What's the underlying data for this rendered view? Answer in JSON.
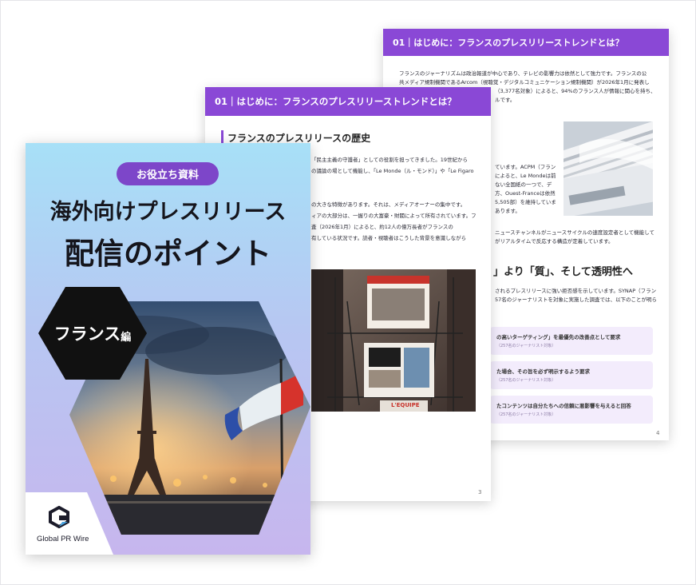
{
  "page_back": {
    "header": "01｜はじめに：フランスのプレスリリーストレンドとは？",
    "lines": [
      "フランスのジャーナリズムは政治報道が中心であり、テレビの影響力は依然として強力です。フランスの公",
      "共メディア規制機関であるArcom（視聴覚・デジタルコミュニケーション規制機関）が2026年1月に発表し",
      "（3,377名対象）によると、94%のフランス人が情報に関心を持ち、",
      "ルです。"
    ],
    "mid_lines": [
      "ています。ACPM（フラン",
      "によると、Le Mondeは前",
      "ない全国紙の一つで、デ",
      "方、Ouest-Franceは依然",
      "5,505部）を維持していま",
      "あります。"
    ],
    "lines2": [
      "ニュースチャンネルがニュースサイクルの速度設定者として機能して",
      "がリアルタイムで反応する構造が定着しています。"
    ],
    "heading": "」より「質」、そして透明性へ",
    "lines3": [
      "されるプレスリリースに強い拒否感を示しています。SYNAP（フラン",
      "57名のジャーナリストを対象に実施した調査では、以下のことが明ら"
    ],
    "items": [
      {
        "text": "の高いターゲティング」を最優先の改善点として要求",
        "note": "（257名のジャーナリスト対象）"
      },
      {
        "text": "た場合、その旨を必ず明示するよう要求",
        "note": "（257名のジャーナリスト対象）"
      },
      {
        "text": "たコンテンツは自分たちへの信頼に悪影響を与えると回答",
        "note": "（257名のジャーナリスト対象）"
      }
    ],
    "page_no": "4"
  },
  "page_mid": {
    "header": "01｜はじめに：フランスのプレスリリーストレンドとは？",
    "heading": "フランスのプレスリリースの歴史",
    "lines": [
      "「民主主義の守護者」としての役割を担ってきました。19世紀から",
      "の議論の場として機能し、「Le Monde（ル・モンド）」や「Le Figaro",
      "",
      "の大きな特徴があります。それは、メディアオーナーの集中です。",
      "ィアの大部分は、一握りの大富豪・財閥によって所有されています。フ",
      "査（2026年1月）によると、約12人の億万長者がフランスの",
      "有している状況です。読者・視聴者はこうした背景を意識しながら"
    ],
    "newsstand_text": "L'EQUIPE",
    "page_no": "3"
  },
  "cover": {
    "badge": "お役立ち資料",
    "title_line1": "海外向けプレスリリース",
    "title_line2": "配信のポイント",
    "hex_main": "フランス",
    "hex_suffix": "編",
    "logo_text": "Global PR Wire"
  },
  "colors": {
    "accent": "#8a48d6",
    "badge": "#7d46c9",
    "pill": "#f3ecfc"
  }
}
